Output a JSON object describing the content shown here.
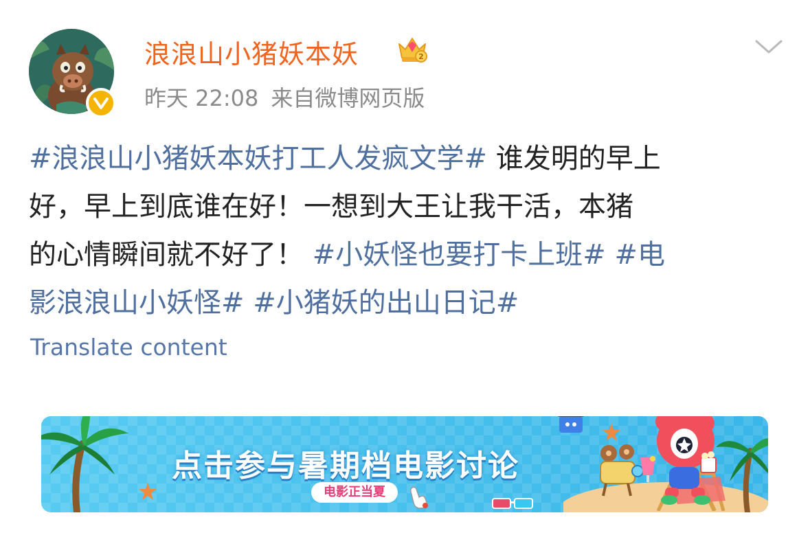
{
  "post": {
    "username": "浪浪山小猪妖本妖",
    "time": "昨天 22:08",
    "source": "来自微博网页版",
    "lines": [
      [
        {
          "t": "#浪浪山小猪妖本妖打工人发疯文学#",
          "tag": true
        },
        {
          "t": " 谁发明的早上",
          "tag": false
        }
      ],
      [
        {
          "t": "好，早上到底谁在好！一想到大王让我干活，本猪",
          "tag": false
        }
      ],
      [
        {
          "t": "的心情瞬间就不好了！ ",
          "tag": false
        },
        {
          "t": "#小妖怪也要打卡上班#",
          "tag": true
        },
        {
          "t": " ",
          "tag": false
        },
        {
          "t": "#电",
          "tag": true
        }
      ],
      [
        {
          "t": "影浪浪山小妖怪#",
          "tag": true
        },
        {
          "t": " ",
          "tag": false
        },
        {
          "t": "#小猪妖的出山日记#",
          "tag": true
        }
      ]
    ],
    "translate_label": "Translate content"
  },
  "banner": {
    "title": "点击参与暑期档电影讨论",
    "chip": "电影正当夏"
  },
  "icons": {
    "avatar": "boar-avatar",
    "verified": "verified-badge-icon",
    "crown": "crown-icon",
    "more": "chevron-down-icon"
  },
  "colors": {
    "username": "#f0641e",
    "hashtag": "#4f6f9f",
    "translate": "#5675a8",
    "verified": "#f5b400",
    "banner": "#44c2ec"
  }
}
